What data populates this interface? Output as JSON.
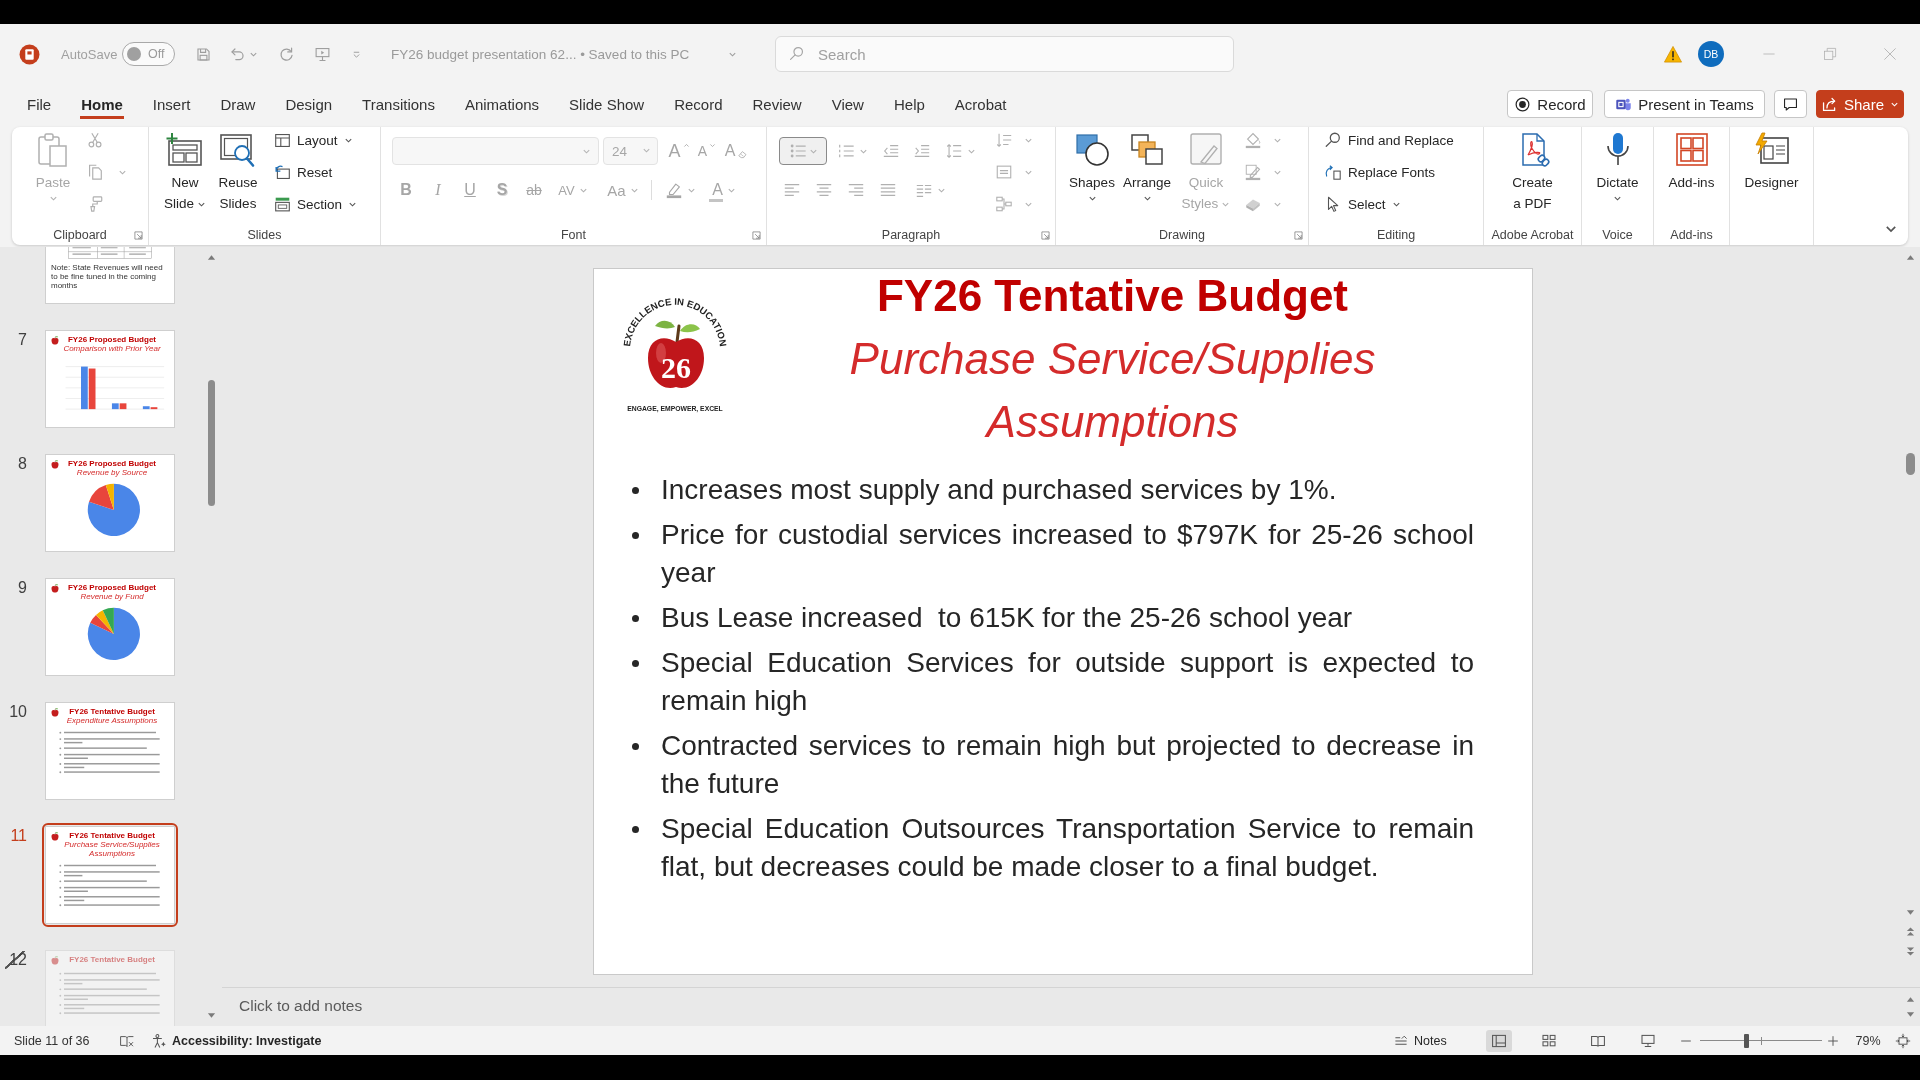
{
  "title_bar": {
    "autosave": {
      "label": "AutoSave",
      "on": false,
      "state_label": "Off"
    },
    "document_title": "FY26 budget presentation 62... • Saved to this PC",
    "search": {
      "placeholder": "Search"
    },
    "account": {
      "initials": "DB"
    }
  },
  "menu": {
    "tabs": [
      {
        "label": "File",
        "selected": false
      },
      {
        "label": "Home",
        "selected": true
      },
      {
        "label": "Insert",
        "selected": false
      },
      {
        "label": "Draw",
        "selected": false
      },
      {
        "label": "Design",
        "selected": false
      },
      {
        "label": "Transitions",
        "selected": false
      },
      {
        "label": "Animations",
        "selected": false
      },
      {
        "label": "Slide Show",
        "selected": false
      },
      {
        "label": "Record",
        "selected": false
      },
      {
        "label": "Review",
        "selected": false
      },
      {
        "label": "View",
        "selected": false
      },
      {
        "label": "Help",
        "selected": false
      },
      {
        "label": "Acrobat",
        "selected": false
      }
    ],
    "record_button": "Record",
    "teams_button": "Present in Teams",
    "share_button": "Share"
  },
  "ribbon": {
    "clipboard": {
      "label": "Clipboard",
      "disabled": true,
      "paste": "Paste"
    },
    "slides": {
      "label": "Slides",
      "new_slide": "New Slide",
      "reuse_slides": "Reuse Slides",
      "layout": "Layout",
      "reset": "Reset",
      "section": "Section"
    },
    "font": {
      "label": "Font",
      "disabled": true,
      "size": "24",
      "size_tools": [
        {
          "kind": "grow",
          "label": "A"
        },
        {
          "kind": "shrink",
          "label": "A"
        },
        {
          "kind": "clear",
          "label": "A"
        }
      ],
      "format_tools": [
        {
          "kind": "bold",
          "label": "B"
        },
        {
          "kind": "italic",
          "label": "I"
        },
        {
          "kind": "underline",
          "label": "U"
        },
        {
          "kind": "shadow",
          "label": "S"
        },
        {
          "kind": "strikethrough",
          "label": "ab"
        },
        {
          "kind": "spacing",
          "label": "AV"
        },
        {
          "kind": "case",
          "label": "Aa"
        }
      ],
      "color_tools": [
        {
          "kind": "highlight"
        },
        {
          "kind": "font-color",
          "label": "A"
        }
      ]
    },
    "paragraph": {
      "label": "Paragraph",
      "disabled": true,
      "bullets": {
        "selected": true
      }
    },
    "drawing": {
      "label": "Drawing",
      "shapes": "Shapes",
      "arrange": "Arrange",
      "quick_styles": {
        "label": "Quick Styles",
        "disabled": true
      }
    },
    "editing": {
      "label": "Editing",
      "find_replace": "Find and Replace",
      "replace_fonts": "Replace Fonts",
      "select": "Select"
    },
    "adobe_acrobat": {
      "label": "Adobe Acrobat",
      "create_pdf": "Create a PDF"
    },
    "voice": {
      "label": "Voice",
      "dictate": "Dictate"
    },
    "add_ins": {
      "label": "Add-ins",
      "add_ins": "Add-ins"
    },
    "designer": {
      "designer": "Designer"
    }
  },
  "slides_pane": {
    "thumbnails": [
      {
        "kind": "table",
        "note": "Note: State Revenues will need to be fine tuned in the coming months",
        "selected": false,
        "hidden": false
      },
      {
        "number": "7",
        "kind": "bar-chart",
        "title": "FY26 Proposed Budget",
        "subtitle": "Comparison with Prior Year",
        "selected": false,
        "hidden": false
      },
      {
        "number": "8",
        "kind": "pie-chart",
        "title": "FY26 Proposed Budget",
        "subtitle": "Revenue by Source",
        "selected": false,
        "hidden": false
      },
      {
        "number": "9",
        "kind": "pie-chart",
        "title": "FY26 Proposed Budget",
        "subtitle": "Revenue by Fund",
        "selected": false,
        "hidden": false
      },
      {
        "number": "10",
        "kind": "bullets",
        "title": "FY26 Tentative Budget",
        "subtitle": "Expenditure Assumptions",
        "selected": false,
        "hidden": false
      },
      {
        "number": "11",
        "kind": "bullets",
        "title": "FY26 Tentative Budget",
        "subtitle": "Purchase Service/Supplies Assumptions",
        "selected": true,
        "hidden": false
      },
      {
        "number": "12",
        "kind": "bullets",
        "title": "FY26 Tentative Budget",
        "selected": false,
        "hidden": true
      }
    ]
  },
  "slide": {
    "logo": {
      "arc_text": "EXCELLENCE IN EDUCATION",
      "number": "26",
      "tagline": "ENGAGE, EMPOWER, EXCEL"
    },
    "title": "FY26 Tentative Budget",
    "subtitle": "Purchase Service/Supplies Assumptions",
    "bullets": [
      "Increases most supply and purchased services by 1%.",
      "Price for custodial services increased to $797K for 25-26 school year",
      "Bus Lease increased  to 615K for the 25-26 school year",
      "Special Education Services for outside support is expected to remain high",
      "Contracted services to remain high but projected to decrease in the future",
      "Special Education Outsources Transportation Service to remain flat, but decreases could be made closer to a final budget."
    ]
  },
  "notes": {
    "placeholder": "Click to add notes"
  },
  "status_bar": {
    "slide_counter": "Slide 11 of 36",
    "accessibility": "Accessibility: Investigate",
    "notes_button": "Notes",
    "view_buttons": [
      {
        "selected": true
      },
      {
        "selected": false
      },
      {
        "selected": false
      },
      {
        "selected": false
      }
    ],
    "zoom": {
      "level": 0.38,
      "reading": "79%"
    }
  }
}
